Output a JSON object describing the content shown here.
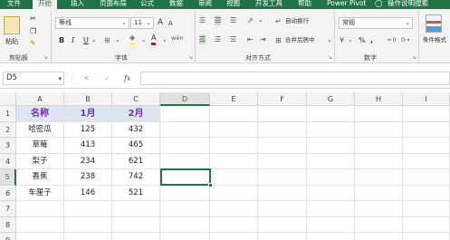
{
  "tabs": [
    "文件",
    "开始",
    "插入",
    "页面布局",
    "公式",
    "数据",
    "审阅",
    "视图",
    "开发工具",
    "帮助",
    "Power Pivot",
    "操作说明搜索"
  ],
  "ribbon": {
    "clipboard": {
      "paste": "粘贴",
      "label": "剪贴板"
    },
    "font": {
      "name": "等线",
      "size": "11",
      "label": "字体",
      "grow": "A",
      "shrink": "A",
      "bold": "B",
      "italic": "I",
      "underline": "U",
      "wen": "wén"
    },
    "alignment": {
      "wrap": "自动换行",
      "merge": "合并后居中",
      "label": "对齐方式"
    },
    "number": {
      "format": "常规",
      "percent": "%",
      "comma": ",",
      "label": "数字",
      "currency": "¥"
    },
    "styles": {
      "label": "条件格式"
    }
  },
  "formula_bar": {
    "name_box": "D5",
    "fx": "fx",
    "content": ""
  },
  "sheet": {
    "columns": [
      "A",
      "B",
      "C",
      "D",
      "E",
      "F",
      "G",
      "H",
      "I"
    ],
    "rows": [
      "1",
      "2",
      "3",
      "4",
      "5",
      "6",
      "7",
      "8",
      "9"
    ],
    "header": [
      "名称",
      "1月",
      "2月"
    ],
    "data": [
      [
        "哈密瓜",
        "125",
        "432"
      ],
      [
        "草莓",
        "413",
        "465"
      ],
      [
        "梨子",
        "234",
        "621"
      ],
      [
        "香蕉",
        "238",
        "742"
      ],
      [
        "车厘子",
        "146",
        "521"
      ]
    ],
    "selected_cell": "D5"
  },
  "colors": {
    "accent": "#217346",
    "header_fill": "#dce6f1",
    "header_text": "#7030a0"
  }
}
